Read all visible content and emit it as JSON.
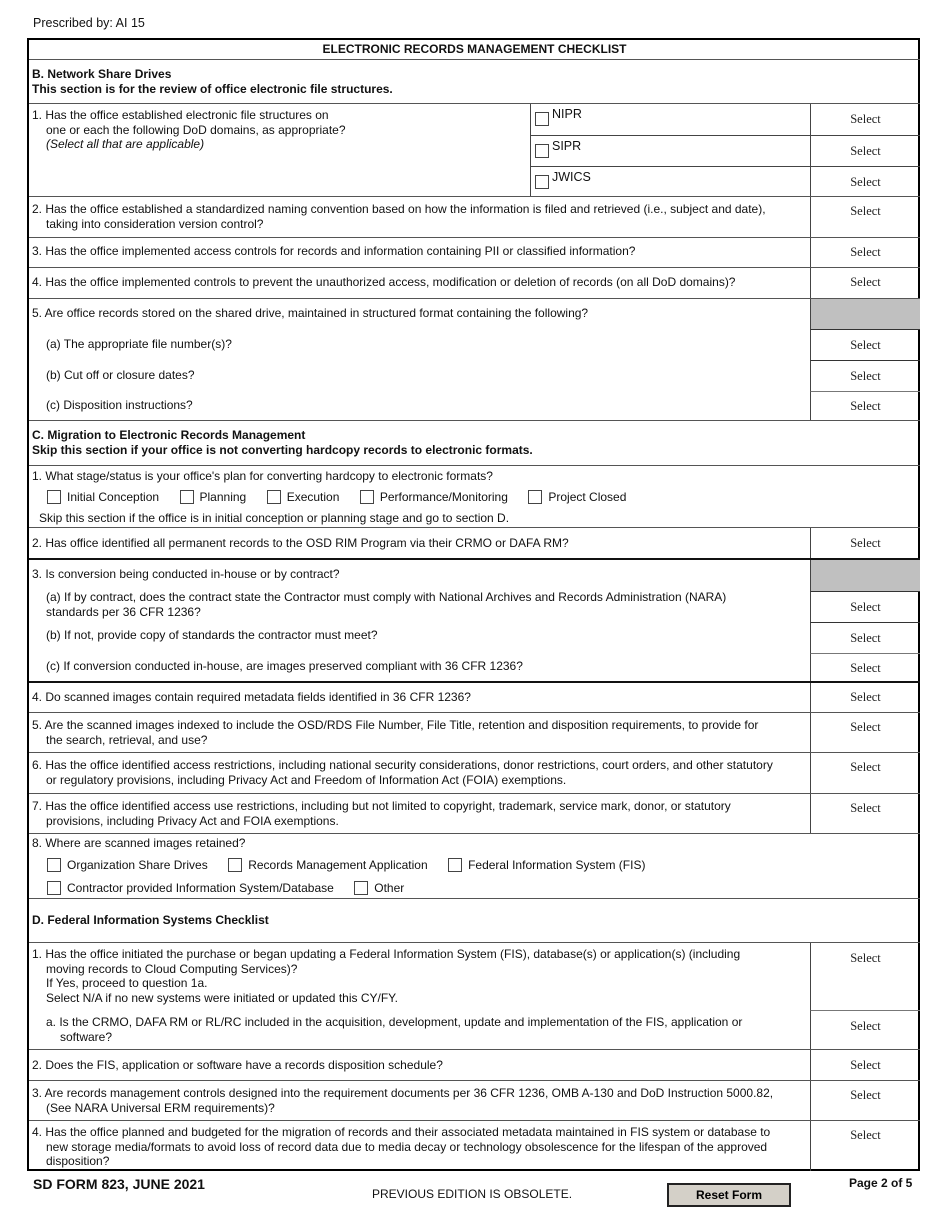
{
  "prescribed_by": "Prescribed by: AI 15",
  "form_title": "ELECTRONIC RECORDS MANAGEMENT CHECKLIST",
  "select_label": "Select",
  "section_b": {
    "heading": "B. Network Share Drives",
    "subheading": "This section is for the review of office electronic file structures.",
    "q1": {
      "line1": "1. Has the office established electronic file structures on",
      "line2": "one or each the following DoD domains, as appropriate?",
      "note": "(Select all that are applicable)",
      "domains": [
        "NIPR",
        "SIPR",
        "JWICS"
      ]
    },
    "q2": {
      "line1": "2. Has the office established a standardized naming convention based on how the information is filed and retrieved (i.e., subject and date),",
      "line2": "taking into consideration version control?"
    },
    "q3": "3. Has the office implemented access controls for records and information containing PII or classified information?",
    "q4": "4. Has the office implemented controls to prevent the unauthorized access, modification or deletion of records (on all DoD domains)?",
    "q5": {
      "text": "5. Are office records stored on the shared drive, maintained in structured format containing the following?",
      "a": "(a) The appropriate file number(s)?",
      "b": "(b) Cut off or closure dates?",
      "c": "(c) Disposition instructions?"
    }
  },
  "section_c": {
    "heading": "C. Migration to Electronic Records Management",
    "subheading": "Skip this section if your office is not converting hardcopy records to electronic formats.",
    "q1": {
      "text": "1. What stage/status is your office's plan for converting hardcopy to electronic formats?",
      "options": [
        "Initial Conception",
        "Planning",
        "Execution",
        "Performance/Monitoring",
        "Project Closed"
      ],
      "note": "Skip this section if the office is in initial conception or planning stage and go to section D."
    },
    "q2": "2. Has office identified all permanent records to the OSD RIM Program via their CRMO or DAFA RM?",
    "q3": {
      "text": "3. Is conversion being conducted in-house or by contract?",
      "a_line1": "(a) If by contract, does the contract state the Contractor must comply with National Archives and Records Administration (NARA)",
      "a_line2": "standards per 36 CFR 1236?",
      "b": "(b) If not, provide copy of standards the contractor must meet?",
      "c": "(c) If conversion conducted in-house, are images preserved compliant with 36 CFR 1236?"
    },
    "q4": "4. Do scanned images contain required metadata fields identified in 36 CFR 1236?",
    "q5": {
      "line1": "5. Are the scanned images indexed to include the OSD/RDS File Number, File Title, retention and disposition requirements, to provide for",
      "line2": "the search, retrieval, and use?"
    },
    "q6": {
      "line1": "6. Has the office identified access restrictions, including national security considerations, donor restrictions, court orders, and other statutory",
      "line2": "or regulatory provisions, including Privacy Act and Freedom of Information Act (FOIA) exemptions."
    },
    "q7": {
      "line1": "7. Has the office identified access use restrictions, including but not limited to copyright, trademark, service mark, donor, or statutory",
      "line2": "provisions, including Privacy Act and FOIA exemptions."
    },
    "q8": {
      "text": "8. Where are scanned images retained?",
      "options_row1": [
        "Organization Share Drives",
        "Records Management Application",
        "Federal Information System (FIS)"
      ],
      "options_row2": [
        "Contractor provided Information System/Database",
        "Other"
      ]
    }
  },
  "section_d": {
    "heading": "D.  Federal Information Systems Checklist",
    "q1": {
      "line1": "1. Has the office initiated the purchase or began updating a Federal Information System (FIS), database(s) or application(s) (including",
      "line2": "moving records to Cloud Computing Services)?",
      "line3": "If Yes, proceed to question 1a.",
      "line4": "Select N/A if no new systems were initiated or updated this CY/FY."
    },
    "q1a": {
      "line1": "a. Is the CRMO, DAFA RM or RL/RC included in the acquisition, development, update and implementation of the FIS, application or",
      "line2": "software?"
    },
    "q2": "2. Does the FIS, application or software have a records disposition schedule?",
    "q3": {
      "line1": "3. Are records management controls designed into the requirement documents per 36 CFR 1236, OMB A-130 and DoD Instruction 5000.82,",
      "line2": "(See NARA Universal ERM requirements)?"
    },
    "q4": {
      "line1": "4. Has the office planned and budgeted for the migration of records and their associated metadata maintained in FIS system or database to",
      "line2": "new storage media/formats to avoid loss of record data due to media decay or technology obsolescence for the lifespan of the approved",
      "line3": "disposition?"
    }
  },
  "footer": {
    "form_id": "SD FORM 823, JUNE 2021",
    "obsolete_note": "PREVIOUS EDITION IS OBSOLETE.",
    "reset_button": "Reset Form",
    "page": "Page 2 of 5"
  }
}
